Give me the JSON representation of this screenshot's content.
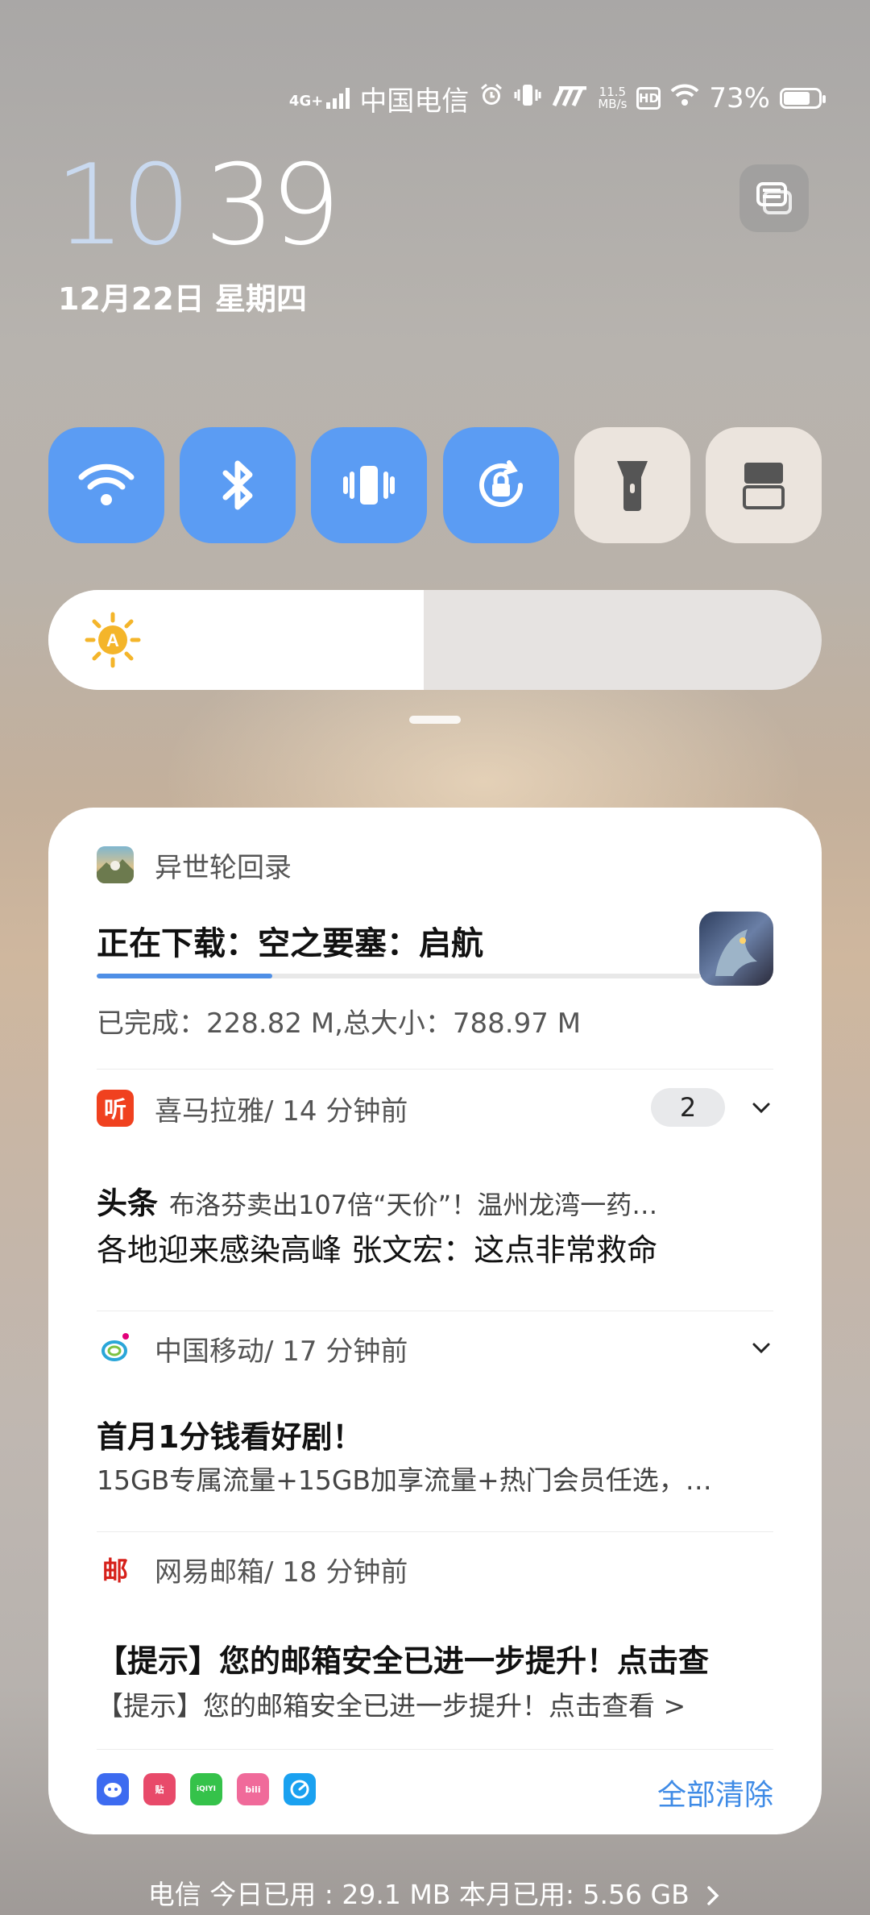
{
  "status_bar": {
    "signal": "4G+",
    "carrier": "中国电信",
    "net_speed_value": "11.5",
    "net_speed_unit": "MB/s",
    "hd": "HD",
    "battery": "73%"
  },
  "clock": {
    "hour": "10",
    "minute": "39",
    "date": "12月22日 星期四"
  },
  "brightness": {
    "level": 0.485,
    "auto_label": "A"
  },
  "notifications": {
    "download": {
      "app": "异世轮回录",
      "title": "正在下载：空之要塞：启航",
      "progress": 0.29,
      "detail": "已完成：228.82 M,总大小：788.97 M"
    },
    "ximalaya": {
      "app": "喜马拉雅",
      "time": " / 14 分钟前",
      "count": "2",
      "tag": "头条",
      "line1": "布洛芬卖出107倍“天价”！温州龙湾一药…",
      "line2": "各地迎来感染高峰 张文宏：这点非常救命",
      "icon_text": "听"
    },
    "cmcc": {
      "app": "中国移动",
      "time": " / 17 分钟前",
      "title": "首月1分钱看好剧！",
      "body": "15GB专属流量+15GB加享流量+热门会员任选，…"
    },
    "mail": {
      "app": "网易邮箱",
      "time": " / 18 分钟前",
      "title": "【提示】您的邮箱安全已进一步提升！点击查",
      "body": "【提示】您的邮箱安全已进一步提升！点击查看 >",
      "icon_text": "邮"
    }
  },
  "bottom_app_icons": [
    {
      "name": "blue-app-icon",
      "text": "",
      "color": "#3d6bf0"
    },
    {
      "name": "tieba-icon",
      "text": "贴",
      "color": "#e84a6a"
    },
    {
      "name": "iqiyi-icon",
      "text": "iQIYI",
      "color": "#35c24a"
    },
    {
      "name": "bilibili-icon",
      "text": "bili",
      "color": "#f06a9a"
    },
    {
      "name": "speed-app-icon",
      "text": "",
      "color": "#1aa1f0"
    }
  ],
  "clear_all": "全部清除",
  "footer": "电信 今日已用 : 29.1 MB 本月已用: 5.56 GB"
}
